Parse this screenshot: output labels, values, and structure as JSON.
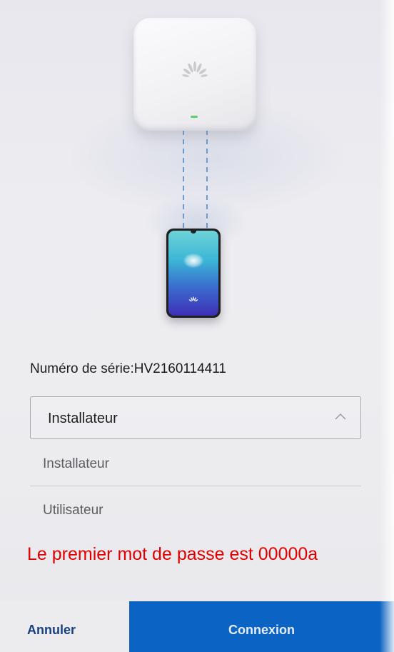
{
  "device": {
    "serial_text": "Numéro de série:HV2160114411"
  },
  "role_select": {
    "selected_value": "Installateur",
    "options": [
      {
        "label": "Installateur"
      },
      {
        "label": "Utilisateur"
      }
    ]
  },
  "note": {
    "text": "Le premier mot de passe est 00000a",
    "color": "#e00000"
  },
  "actions": {
    "cancel_label": "Annuler",
    "connect_label": "Connexion"
  },
  "colors": {
    "primary_button": "#0b64c4",
    "cancel_text": "#17407f"
  },
  "icons": {
    "select_indicator": "chevron-up-icon",
    "brand_logo": "huawei-logo"
  }
}
